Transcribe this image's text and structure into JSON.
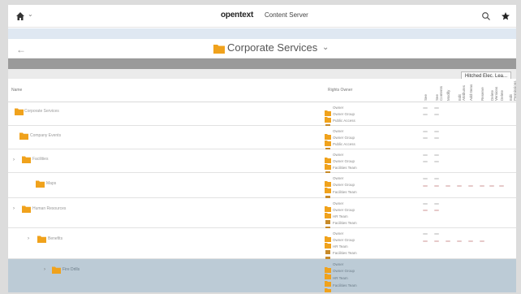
{
  "header": {
    "brand": "opentext",
    "product": "Content Server"
  },
  "title_row": {
    "title": "Corporate Services"
  },
  "toolbar": {
    "permissions_button": "Hitched Elec. Lea..."
  },
  "columns": {
    "name": "Name",
    "rights": "Rights Owner",
    "permissions": [
      "See",
      "See Contents",
      "Modify",
      "Edit Attributes",
      "Add Items",
      "Reserve",
      "Delete Versions",
      "Delete",
      "Edit Permissions"
    ]
  },
  "rows": [
    {
      "name": "Corporate Services",
      "rights": [
        "Owner",
        "Owner Group",
        "Public Access"
      ],
      "selected": false
    },
    {
      "name": "Company Events",
      "rights": [
        "Owner",
        "Owner Group",
        "Public Access"
      ],
      "selected": false
    },
    {
      "name": "Facilities",
      "rights": [
        "Owner",
        "Owner Group",
        "Facilities Team"
      ],
      "selected": false
    },
    {
      "name": "Maps",
      "rights": [
        "Owner",
        "Owner Group",
        "Facilities Team"
      ],
      "selected": false
    },
    {
      "name": "Human Resources",
      "rights": [
        "Owner",
        "Owner Group",
        "HR Team",
        "Facilities Team"
      ],
      "selected": false
    },
    {
      "name": "Benefits",
      "rights": [
        "Owner",
        "Owner Group",
        "HR Team",
        "Facilities Team"
      ],
      "selected": false
    },
    {
      "name": "Fire Drills",
      "rights": [
        "Owner",
        "Owner Group",
        "HR Team",
        "Facilities Team"
      ],
      "selected": true
    }
  ],
  "colors": {
    "folder": "#f0a21c",
    "selected_row": "#bccbd6",
    "toolbar": "#9a9a9a"
  }
}
